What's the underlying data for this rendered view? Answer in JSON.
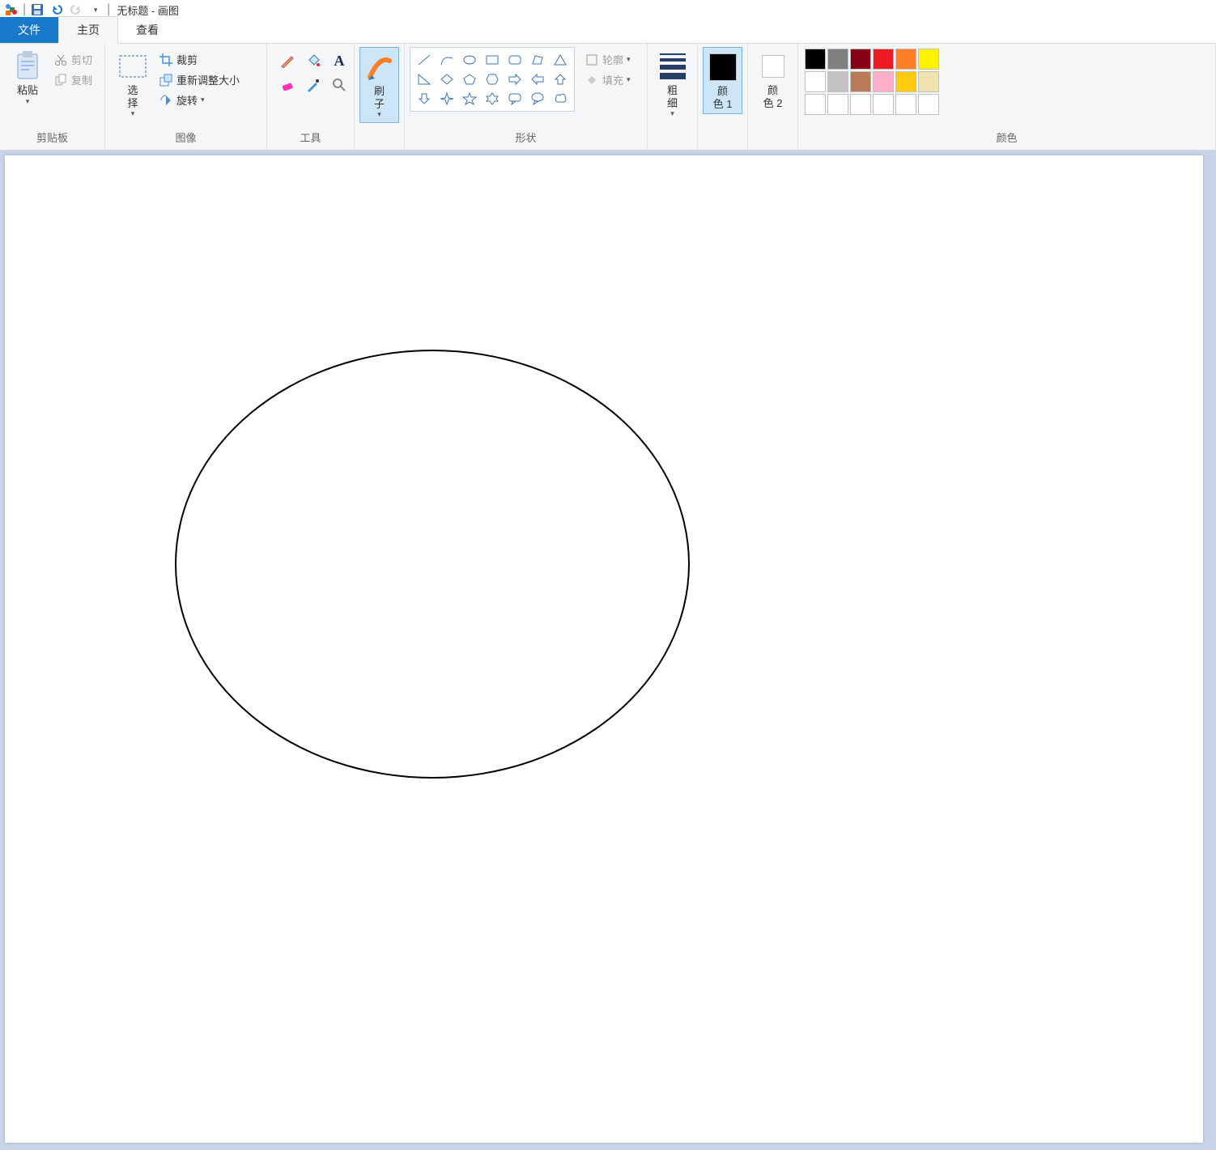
{
  "title": "无标题 - 画图",
  "tabs": {
    "file": "文件",
    "home": "主页",
    "view": "查看"
  },
  "groups": {
    "clipboard": {
      "label": "剪贴板",
      "paste": "粘贴",
      "cut": "剪切",
      "copy": "复制"
    },
    "image": {
      "label": "图像",
      "select": "选\n择",
      "crop": "裁剪",
      "resize": "重新调整大小",
      "rotate": "旋转"
    },
    "tools": {
      "label": "工具"
    },
    "brush": {
      "label": "刷\n子"
    },
    "shapes": {
      "label": "形状",
      "outline": "轮廓",
      "fill": "填充"
    },
    "thickness": {
      "label": "粗\n细"
    },
    "color1": {
      "label": "颜\n色 1"
    },
    "color2": {
      "label": "颜\n色 2"
    },
    "colors": {
      "label": "颜色"
    }
  },
  "palette_row1": [
    "#000000",
    "#7f7f7f",
    "#880015",
    "#ed1c24",
    "#ff7f27",
    "#fff200"
  ],
  "palette_row2": [
    "#ffffff",
    "#c3c3c3",
    "#b97a57",
    "#ffaec9",
    "#ffc90e",
    "#efe4b0"
  ],
  "palette_row3": [
    "#ffffff",
    "#ffffff",
    "#ffffff",
    "#ffffff",
    "#ffffff",
    "#ffffff"
  ]
}
